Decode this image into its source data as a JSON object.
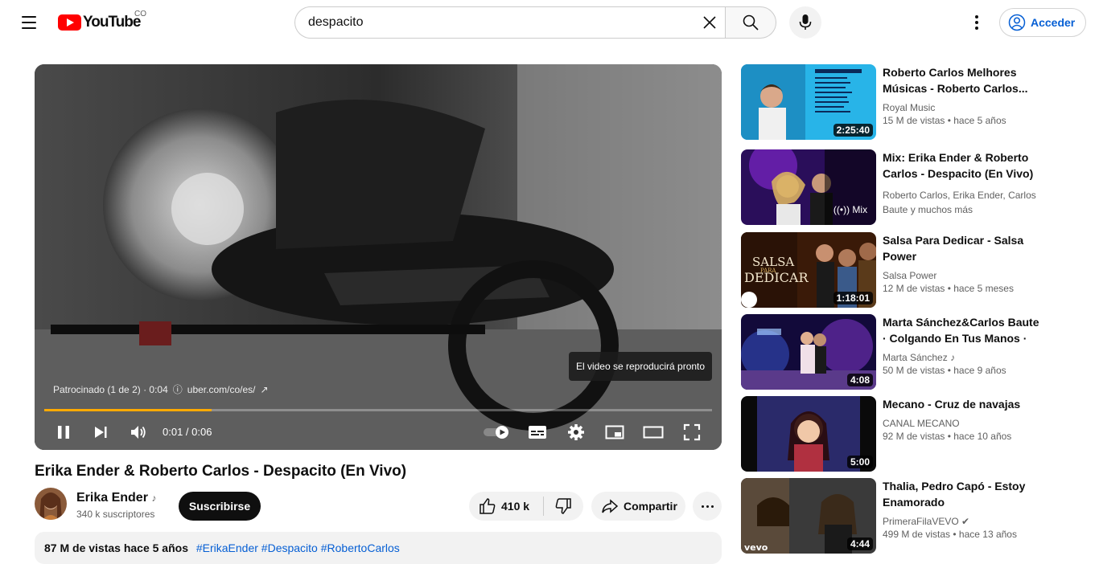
{
  "header": {
    "logo_text": "YouTube",
    "country_code": "CO",
    "search_value": "despacito",
    "signin_label": "Acceder"
  },
  "player": {
    "sponsor_text": "Patrocinado (1 de 2) · 0:04",
    "sponsor_link": "uber.com/co/es/",
    "toast": "El video se reproducirá pronto",
    "time": "0:01 / 0:06",
    "progress_fraction": 0.25,
    "progress_color": "#ffaa00"
  },
  "video": {
    "title": "Erika Ender & Roberto Carlos - Despacito (En Vivo)",
    "channel": "Erika Ender",
    "subscribers": "340 k suscriptores",
    "subscribe_label": "Suscribirse",
    "likes": "410 k",
    "share_label": "Compartir",
    "description_meta": "87 M de vistas  hace 5 años",
    "description_tags": "#ErikaEnder #Despacito #RobertoCarlos"
  },
  "sidebar": [
    {
      "title": "Roberto Carlos Melhores Músicas - Roberto Carlos...",
      "channel": "Royal Music",
      "views": "15 M de vistas",
      "age": "hace 5 años",
      "duration": "2:25:40"
    },
    {
      "title": "Mix: Erika Ender & Roberto Carlos - Despacito (En Vivo)",
      "channel": "Roberto Carlos, Erika Ender, Carlos Baute y muchos más",
      "views": "",
      "age": "",
      "duration": "Mix"
    },
    {
      "title": "Salsa Para Dedicar - Salsa Power",
      "channel": "Salsa Power",
      "views": "12 M de vistas",
      "age": "hace 5 meses",
      "duration": "1:18:01"
    },
    {
      "title": "Marta Sánchez&Carlos Baute · Colgando En Tus Manos ·",
      "channel": "Marta Sánchez",
      "views": "50 M de vistas",
      "age": "hace 9 años",
      "duration": "4:08"
    },
    {
      "title": "Mecano - Cruz de navajas",
      "channel": "CANAL MECANO",
      "views": "92 M de vistas",
      "age": "hace 10 años",
      "duration": "5:00"
    },
    {
      "title": "Thalia, Pedro Capó - Estoy Enamorado",
      "channel": "PrimeraFilaVEVO",
      "views": "499 M de vistas",
      "age": "hace 13 años",
      "duration": "4:44"
    }
  ]
}
